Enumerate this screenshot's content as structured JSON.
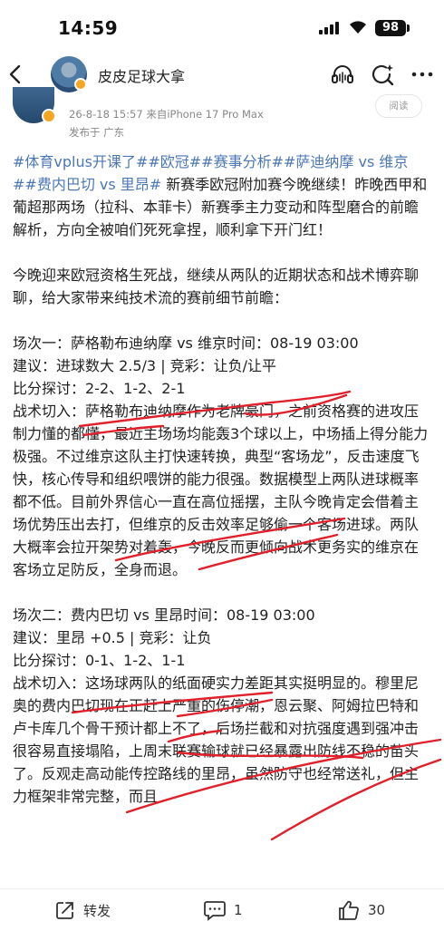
{
  "status": {
    "time": "14:59",
    "battery": "98"
  },
  "nav": {
    "title": "皮皮足球大拿"
  },
  "author": {
    "meta": "26-8-18 15:57  来自iPhone 17 Pro Max",
    "location": "发布于 广东",
    "read_label": "阅读"
  },
  "post": {
    "tags": "#体育vplus开课了##欧冠##赛事分析##萨迪纳摩 vs 维京##费内巴切 vs 里昂#",
    "intro": " 新赛季欧冠附加赛今晚继续！昨晚西甲和葡超那两场（拉科、本菲卡）新赛季主力变动和阵型磨合的前瞻解析，方向全被咱们死死拿捏，顺利拿下开门红！",
    "para2": "今晚迎来欧冠资格生死战，继续从两队的近期状态和战术博弈聊聊，给大家带来纯技术流的赛前细节前瞻：",
    "match1": {
      "title": "场次一：萨格勒布迪纳摩 vs 维京时间：08-19 03:00",
      "advice": "建议：进球数大 2.5/3 | 竞彩：让负/让平",
      "score": "比分探讨：2-2、1-2、2-1",
      "tactics": "战术切入：萨格勒布迪纳摩作为老牌豪门，之前资格赛的进攻压制力懂的都懂，最近主场场均能轰3个球以上，中场插上得分能力极强。不过维京这队主打快速转换，典型“客场龙”，反击速度飞快，核心传导和组织喂饼的能力很强。数据模型上两队进球概率都不低。目前外界信心一直在高位摇摆，主队今晚肯定会借着主场优势压出去打，但维京的反击效率足够偷一个客场进球。两队大概率会拉开架势对着轰，今晚反而更倾向战术更务实的维京在客场立足防反，全身而退。"
    },
    "match2": {
      "title": "场次二：费内巴切 vs 里昂时间：08-19 03:00",
      "advice": "建议：里昂 +0.5 | 竞彩：让负",
      "score": "比分探讨：0-1、1-2、1-1",
      "tactics": "战术切入：这场球两队的纸面硬实力差距其实挺明显的。穆里尼奥的费内巴切现在正赶上严重的伤停潮，恩云聚、阿姆拉巴特和卢卡库几个骨干预计都上不了，后场拦截和对抗强度遇到强冲击很容易直接塌陷，上周末联赛输球就已经暴露出防线不稳的苗头了。反观走高动能传控路线的里昂，虽然防守也经常送礼，但主力框架非常完整，而且"
    }
  },
  "toolbar": {
    "repost_label": "转发",
    "comment_count": "1",
    "like_count": "30"
  }
}
